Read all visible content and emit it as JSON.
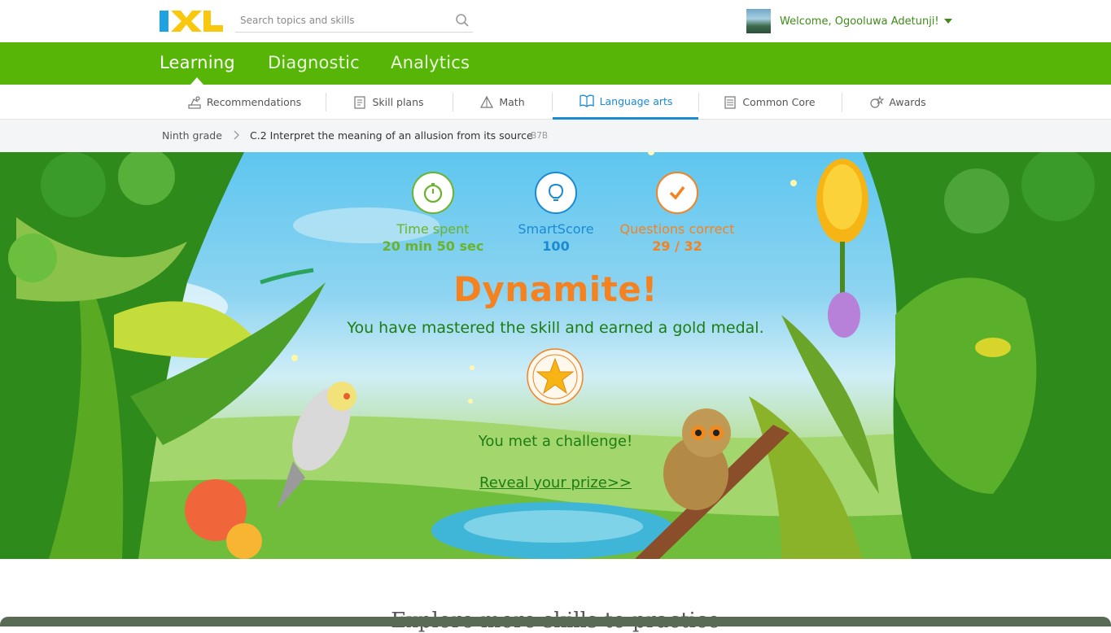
{
  "header": {
    "logo_text": "IXL",
    "search_placeholder": "Search topics and skills",
    "welcome": "Welcome, Ogooluwa Adetunji!"
  },
  "main_nav": {
    "tabs": [
      {
        "label": "Learning",
        "active": true
      },
      {
        "label": "Diagnostic",
        "active": false
      },
      {
        "label": "Analytics",
        "active": false
      }
    ]
  },
  "sub_nav": {
    "tabs": [
      {
        "label": "Recommendations",
        "icon": "recommendations-icon",
        "active": false
      },
      {
        "label": "Skill plans",
        "icon": "skill-plans-icon",
        "active": false
      },
      {
        "label": "Math",
        "icon": "math-icon",
        "active": false
      },
      {
        "label": "Language arts",
        "icon": "language-arts-icon",
        "active": true
      },
      {
        "label": "Common Core",
        "icon": "common-core-icon",
        "active": false
      },
      {
        "label": "Awards",
        "icon": "awards-icon",
        "active": false
      }
    ]
  },
  "breadcrumb": {
    "grade": "Ninth grade",
    "skill": "C.2 Interpret the meaning of an allusion from its source",
    "code": "B7B"
  },
  "results": {
    "time_label": "Time spent",
    "time_value": "20 min 50 sec",
    "score_label": "SmartScore",
    "score_value": "100",
    "correct_label": "Questions correct",
    "correct_value": "29 / 32",
    "headline": "Dynamite!",
    "message": "You have mastered the skill and earned a gold medal.",
    "challenge": "You met a challenge!",
    "prize_link": "Reveal your prize>>"
  },
  "colors": {
    "green_nav": "#56b506",
    "time": "#6bb32a",
    "score": "#1a8ad1",
    "correct": "#f58220",
    "message": "#1c7d12"
  },
  "bottom": {
    "explore": "Explore more skills to practice"
  }
}
